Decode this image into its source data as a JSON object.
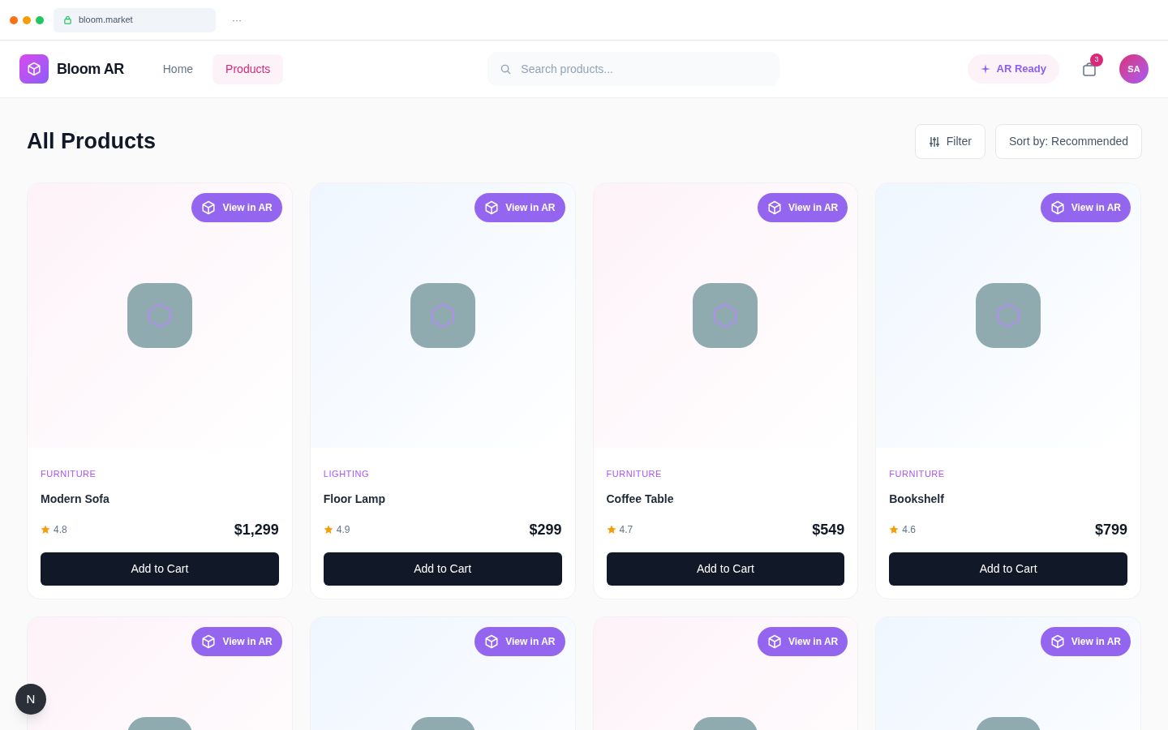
{
  "browser": {
    "url": "bloom.market",
    "menu": "···"
  },
  "header": {
    "brand": "Bloom AR",
    "nav": [
      {
        "label": "Home",
        "selected": false
      },
      {
        "label": "Products",
        "selected": true
      }
    ],
    "search": {
      "placeholder": "Search products..."
    },
    "ar_status": "AR Ready",
    "cart_count": "3",
    "avatar": "SA"
  },
  "page": {
    "title": "All Products",
    "filter": "Filter",
    "sort": "Sort by: Recommended"
  },
  "products": [
    {
      "ar_button": "View in AR",
      "color": "#fdf2f8",
      "category": "FURNITURE",
      "name": "Modern Sofa",
      "rating": "4.8",
      "price": "$1,299",
      "action": "Add to Cart"
    },
    {
      "ar_button": "View in AR",
      "color": "#eff6ff",
      "category": "LIGHTING",
      "name": "Floor Lamp",
      "rating": "4.9",
      "price": "$299",
      "action": "Add to Cart"
    },
    {
      "ar_button": "View in AR",
      "color": "#fdf2f8",
      "category": "FURNITURE",
      "name": "Coffee Table",
      "rating": "4.7",
      "price": "$549",
      "action": "Add to Cart"
    },
    {
      "ar_button": "View in AR",
      "color": "#eff6ff",
      "category": "FURNITURE",
      "name": "Bookshelf",
      "rating": "4.6",
      "price": "$799",
      "action": "Add to Cart"
    },
    {
      "ar_button": "View in AR",
      "color": "#fdf2f8"
    },
    {
      "ar_button": "View in AR",
      "color": "#eff6ff"
    },
    {
      "ar_button": "View in AR",
      "color": "#fdf2f8"
    },
    {
      "ar_button": "View in AR",
      "color": "#eff6ff"
    }
  ],
  "dev_badge": "N"
}
